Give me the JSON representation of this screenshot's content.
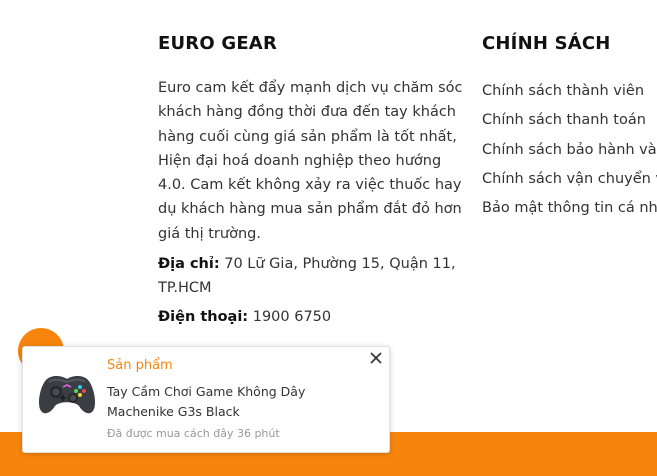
{
  "about": {
    "heading": "EURO GEAR",
    "description": "Euro cam kết đẩy mạnh dịch vụ chăm sóc khách hàng đồng thời đưa đến tay khách hàng cuối cùng giá sản phẩm là tốt nhất, Hiện đại hoá doanh nghiệp theo hướng 4.0. Cam kết không xảy ra việc thuốc hay dụ khách hàng mua sản phẩm đắt đỏ hơn giá thị trường.",
    "address_label": "Địa chỉ:",
    "address_value": "70 Lữ Gia, Phường 15, Quận 11, TP.HCM",
    "phone_label": "Điện thoại:",
    "phone_value": "1900 6750"
  },
  "policy": {
    "heading": "CHÍNH SÁCH",
    "items": [
      "Chính sách thành viên",
      "Chính sách thanh toán",
      "Chính sách bảo hành và",
      "Chính sách vận chuyển v",
      "Bảo mật thông tin cá nh"
    ]
  },
  "popup": {
    "category": "Sản phẩm",
    "product_title": "Tay Cầm Chơi Game Không Dây Machenike G3s Black",
    "time_text": "Đã được mua cách đây 36 phút",
    "thumbnail_icon": "gamepad-icon",
    "close_icon": "close-icon"
  },
  "colors": {
    "accent": "#f7850d",
    "text": "#333333",
    "muted": "#999999"
  }
}
